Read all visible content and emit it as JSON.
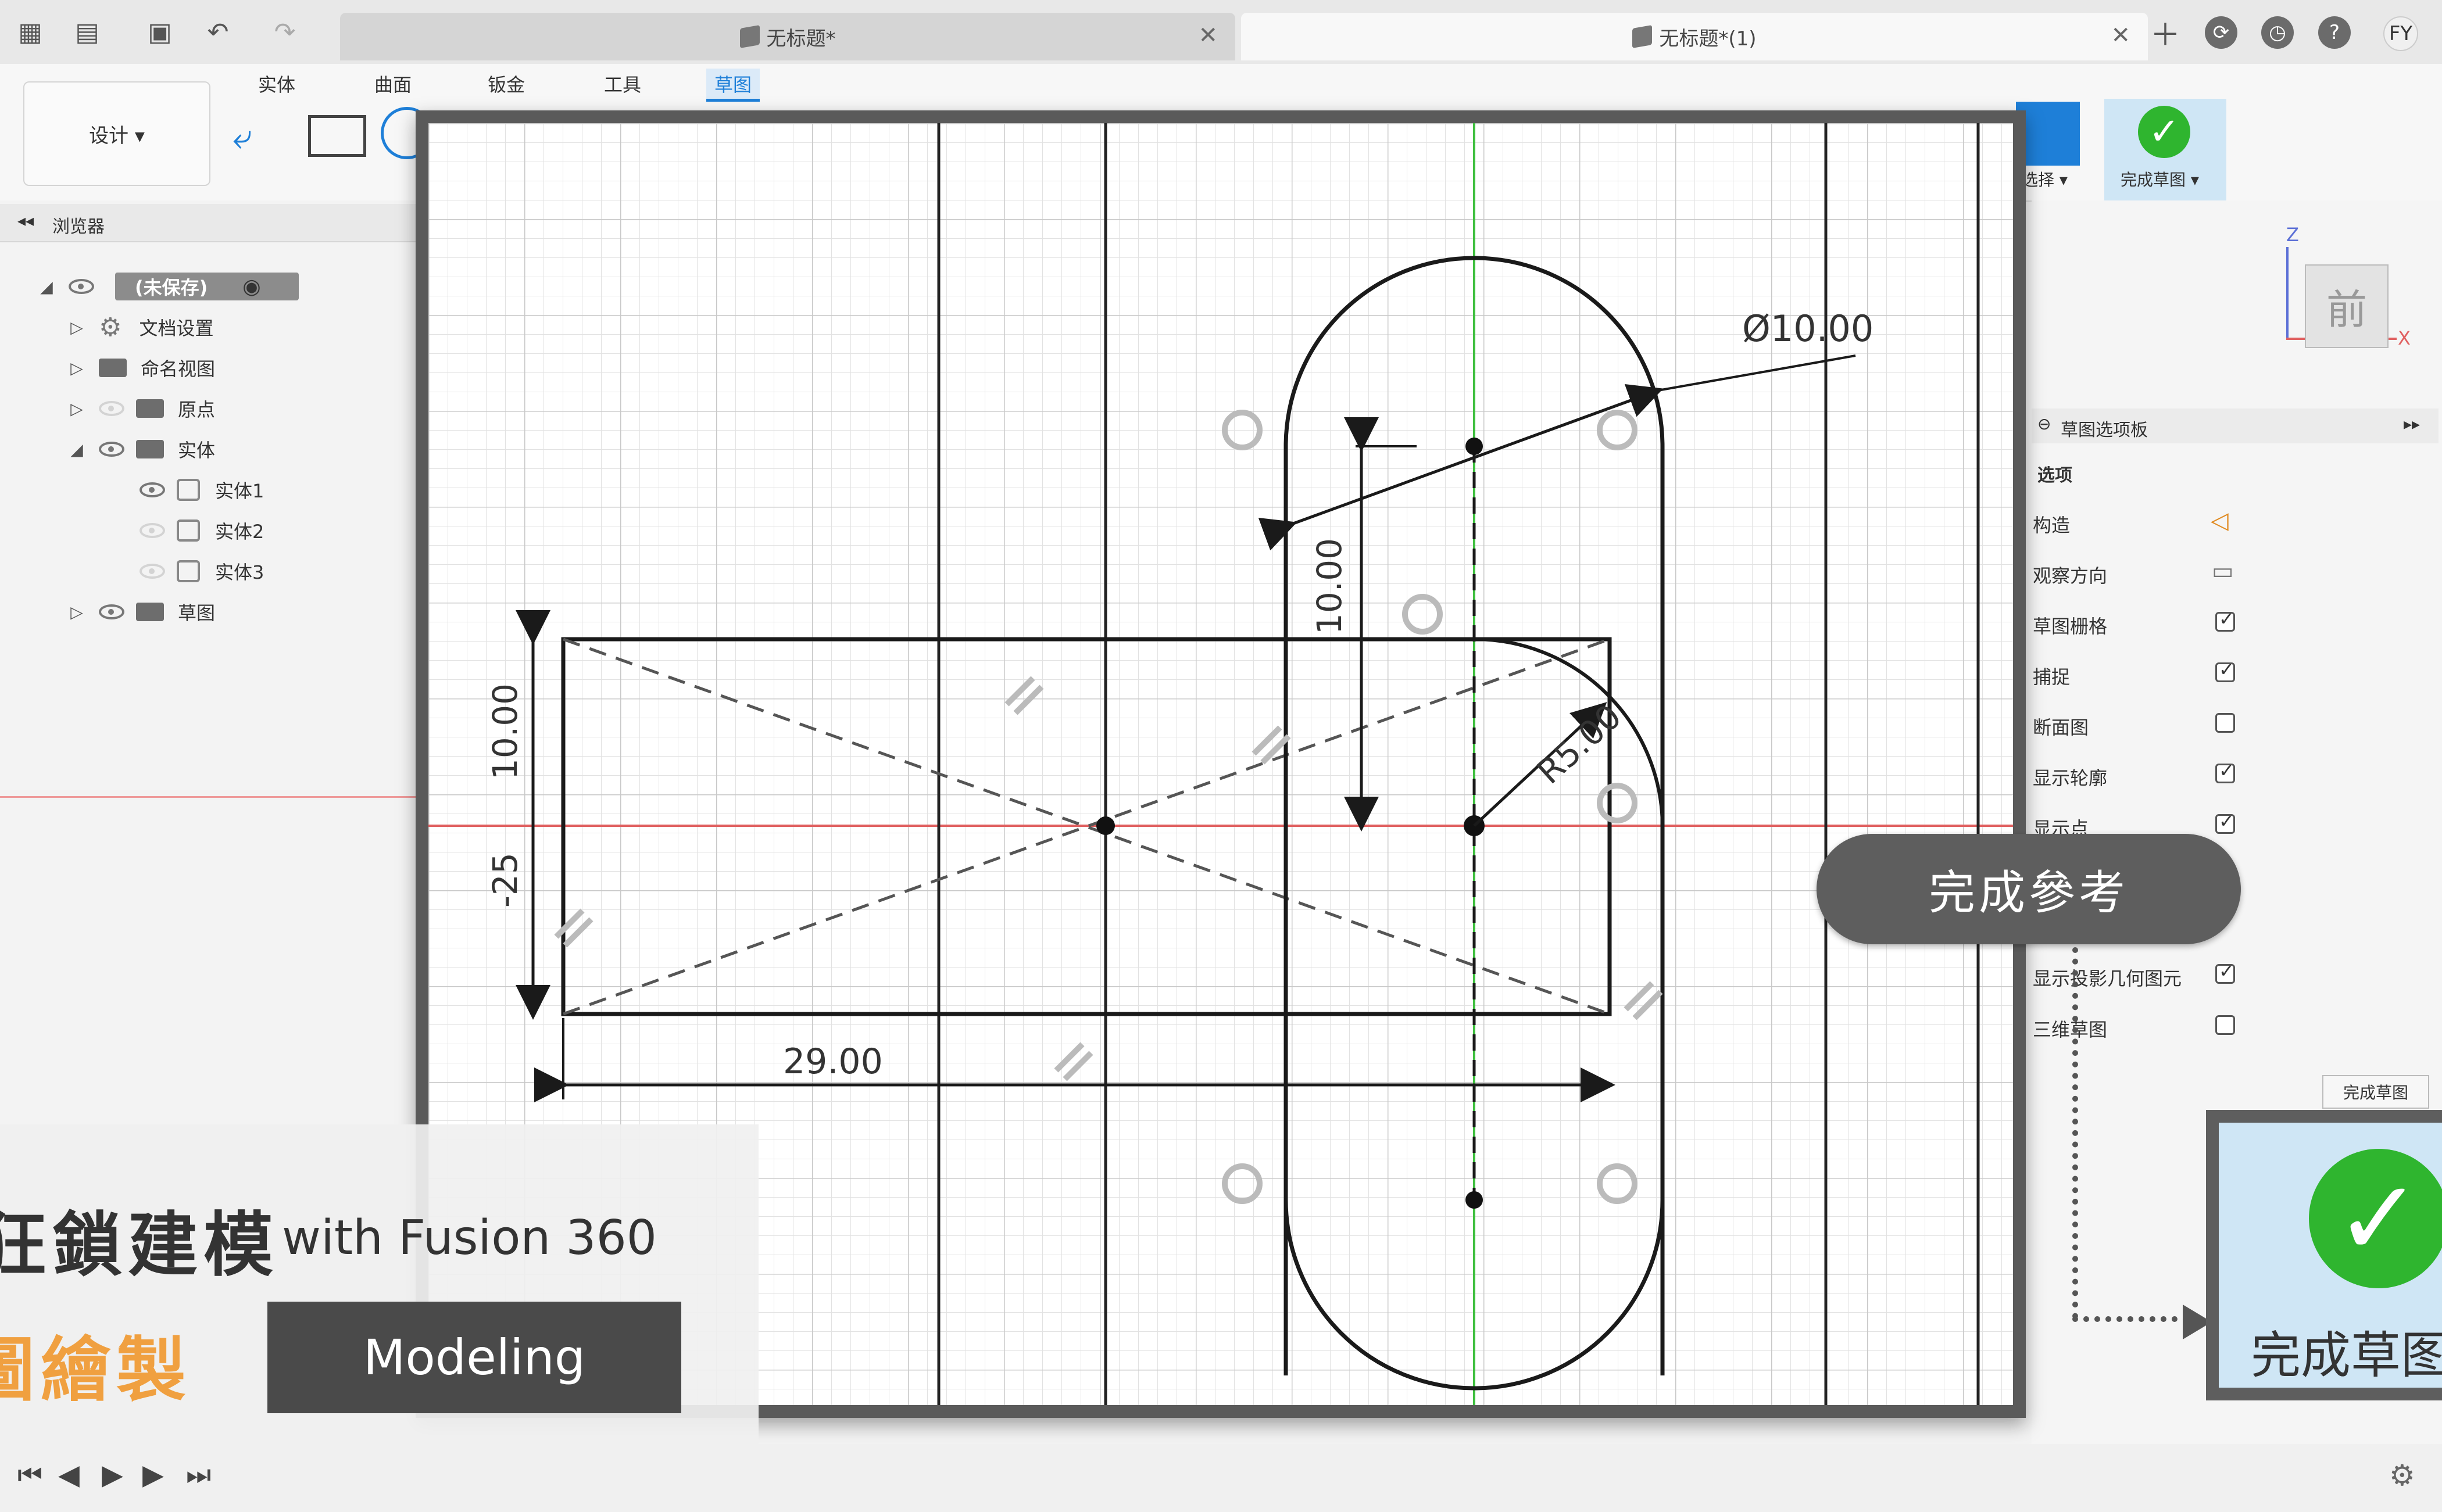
{
  "tabs": [
    {
      "label": "无标题*"
    },
    {
      "label": "无标题*(1)"
    }
  ],
  "user_initials": "FY",
  "toolbar": {
    "design_label": "设计 ▾",
    "tabs": [
      "实体",
      "曲面",
      "钣金",
      "工具",
      "草图"
    ],
    "active_tab": "草图",
    "select_label": "选择 ▾",
    "finish_sketch_label": "完成草图 ▾"
  },
  "browser": {
    "title": "浏览器",
    "root": "(未保存)",
    "items": [
      "文档设置",
      "命名视图",
      "原点",
      "实体",
      "实体1",
      "实体2",
      "实体3",
      "草图"
    ]
  },
  "viewcube": {
    "face": "前",
    "axis_z": "Z",
    "axis_x": "X"
  },
  "sketch_palette": {
    "title": "草图选项板",
    "section": "选项",
    "options": [
      {
        "label": "构造",
        "kind": "icon"
      },
      {
        "label": "观察方向",
        "kind": "icon"
      },
      {
        "label": "草图栅格",
        "checked": true
      },
      {
        "label": "捕捉",
        "checked": true
      },
      {
        "label": "断面图",
        "checked": false
      },
      {
        "label": "显示轮廓",
        "checked": true
      },
      {
        "label": "显示点",
        "checked": true
      },
      {
        "label": "显示投影几何图元",
        "checked": true
      },
      {
        "label": "三维草图",
        "checked": false
      }
    ],
    "finish_button": "完成草图"
  },
  "dimensions": {
    "diameter": "Ø10.00",
    "vertical_top": "10.00",
    "radius": "R5.00",
    "left_height": "10.00",
    "left_offset": "-25",
    "bottom_width": "29.00"
  },
  "callouts": {
    "finish_reference": "完成參考",
    "finish_sketch_big": "完成草图"
  },
  "overlay": {
    "title_cn": "狂鎖建模",
    "title_en": "with Fusion 360",
    "subtitle_cn": "圖繪製",
    "badge": "Modeling"
  },
  "colors": {
    "accent_orange": "#f0a040",
    "check_green": "#2fb52f",
    "sketch_line": "#1a1a1a",
    "axis_red": "#e06060",
    "axis_green": "#40c040",
    "active_blue": "#1e7fd8"
  }
}
